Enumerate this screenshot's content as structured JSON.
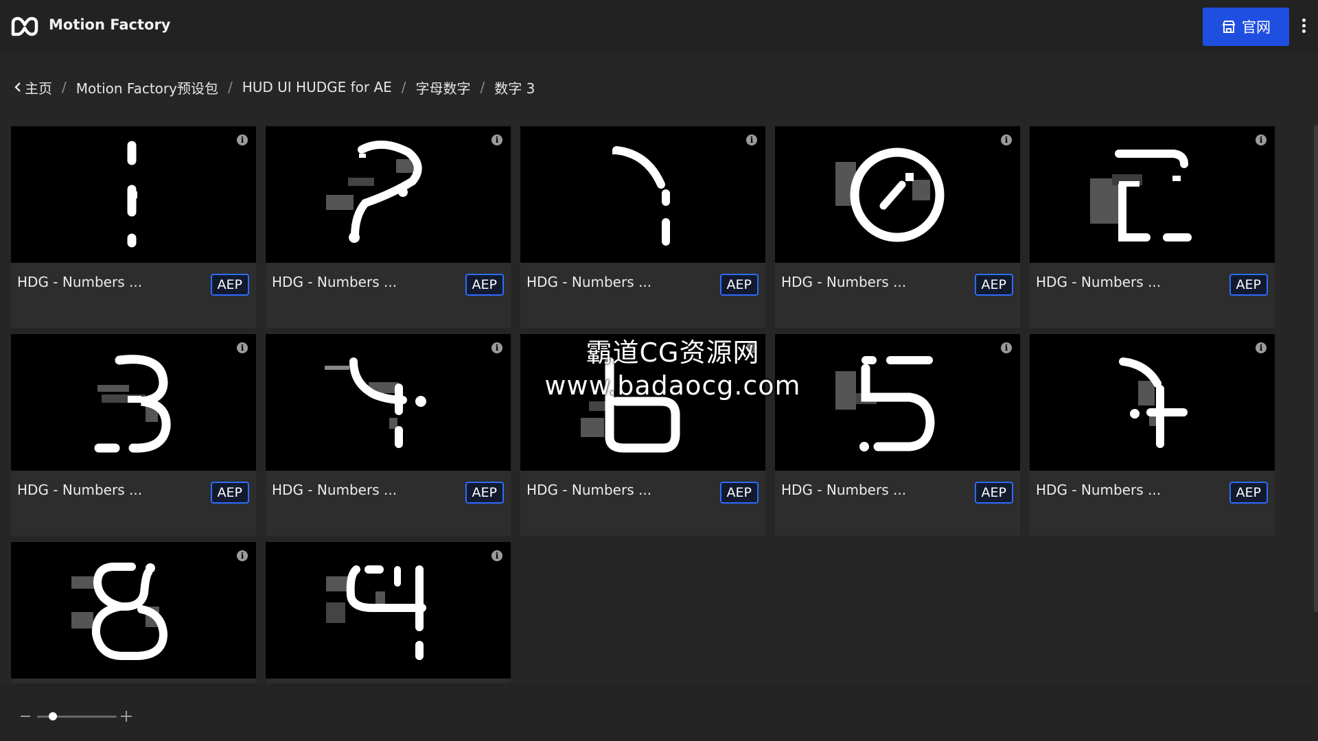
{
  "header": {
    "app_title": "Motion Factory",
    "site_button_label": "官网",
    "logo_icon": "motion-factory-logo",
    "more_icon": "more-vertical-icon"
  },
  "breadcrumb": {
    "back_icon": "chevron-left-icon",
    "items": [
      "主页",
      "Motion Factory预设包",
      "HUD UI HUDGE for AE",
      "字母数字",
      "数字 3"
    ],
    "separator": "/"
  },
  "assets": [
    {
      "title": "HDG - Numbers ...",
      "format": "AEP",
      "glyph": "1"
    },
    {
      "title": "HDG - Numbers ...",
      "format": "AEP",
      "glyph": "?"
    },
    {
      "title": "HDG - Numbers ...",
      "format": "AEP",
      "glyph": "7"
    },
    {
      "title": "HDG - Numbers ...",
      "format": "AEP",
      "glyph": "0"
    },
    {
      "title": "HDG - Numbers ...",
      "format": "AEP",
      "glyph": "2"
    },
    {
      "title": "HDG - Numbers ...",
      "format": "AEP",
      "glyph": "3"
    },
    {
      "title": "HDG - Numbers ...",
      "format": "AEP",
      "glyph": "4"
    },
    {
      "title": "HDG - Numbers ...",
      "format": "AEP",
      "glyph": "6"
    },
    {
      "title": "HDG - Numbers ...",
      "format": "AEP",
      "glyph": "5"
    },
    {
      "title": "HDG - Numbers ...",
      "format": "AEP",
      "glyph": "+"
    },
    {
      "title": "",
      "format": "",
      "glyph": "8"
    },
    {
      "title": "",
      "format": "",
      "glyph": "4"
    }
  ],
  "zoom": {
    "level": 0.2
  },
  "watermark": {
    "line1": "霸道CG资源网",
    "line2": "www.badaocg.com"
  },
  "colors": {
    "accent": "#1f4fe0",
    "badge_border": "#2f6bff",
    "background": "#262626"
  }
}
